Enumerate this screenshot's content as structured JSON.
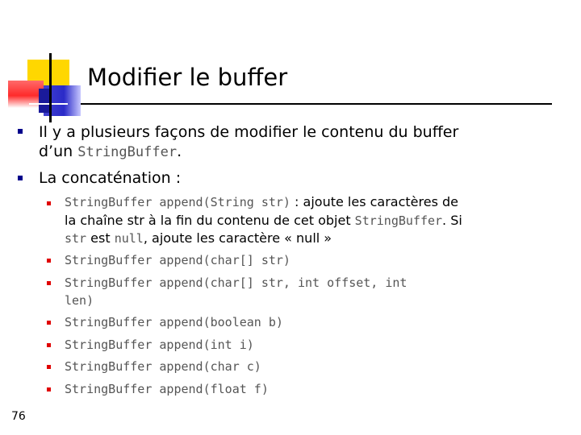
{
  "title": "Modifier le buffer",
  "page_number": "76",
  "bullets": {
    "b1": {
      "line1": "Il y a plusieurs façons de modifier le contenu du buffer",
      "line2_text": "d’un ",
      "line2_code": "StringBuffer",
      "line2_end": "."
    },
    "b2": "La concaténation :"
  },
  "sub": {
    "s1": {
      "code": "StringBuffer append(String str)",
      "text1": " : ajoute les caractères de",
      "line2_text": "la chaîne str à la fin du contenu de cet objet ",
      "line2_code": "StringBuffer",
      "line2_end": ". Si",
      "line3_code1": "str",
      "line3_text1": " est ",
      "line3_code2": "null",
      "line3_text2": ", ajoute les caractère « null »"
    },
    "s2": "StringBuffer append(char[] str)",
    "s3_line1": "StringBuffer append(char[] str, int offset, int",
    "s3_line2": "len)",
    "s4": "StringBuffer append(boolean b)",
    "s5": "StringBuffer append(int i)",
    "s6": "StringBuffer append(char c)",
    "s7": "StringBuffer append(float f)"
  },
  "colors": {
    "bullet_main": "#00008b",
    "bullet_sub": "#e00000",
    "code_text": "#555555",
    "deco_yellow": "#ffd700",
    "deco_red": "#ff2a2a",
    "deco_blue": "#2a2ac8"
  }
}
